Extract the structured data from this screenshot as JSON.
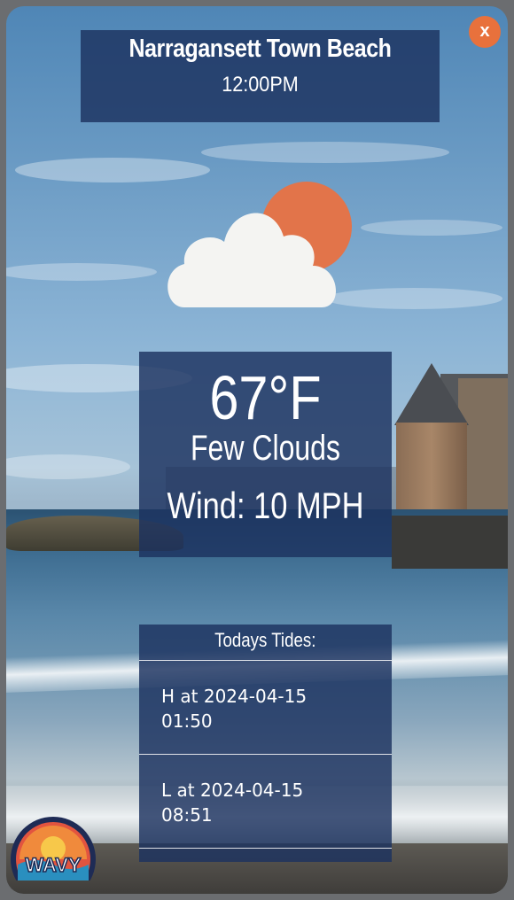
{
  "header": {
    "location": "Narragansett Town Beach",
    "time": "12:00PM"
  },
  "close_label": "x",
  "weather": {
    "icon": "partly-cloudy-icon",
    "temperature": "67°F",
    "condition": "Few Clouds",
    "wind": "Wind: 10 MPH"
  },
  "tides": {
    "heading": "Todays Tides:",
    "items": [
      {
        "line1": "H at 2024-04-15",
        "line2": "01:50"
      },
      {
        "line1": "L at 2024-04-15",
        "line2": "08:51"
      }
    ]
  },
  "logo": {
    "text": "WAVY"
  },
  "colors": {
    "panel": "#1c325f",
    "close": "#e8713c",
    "sun": "#e2744a"
  }
}
